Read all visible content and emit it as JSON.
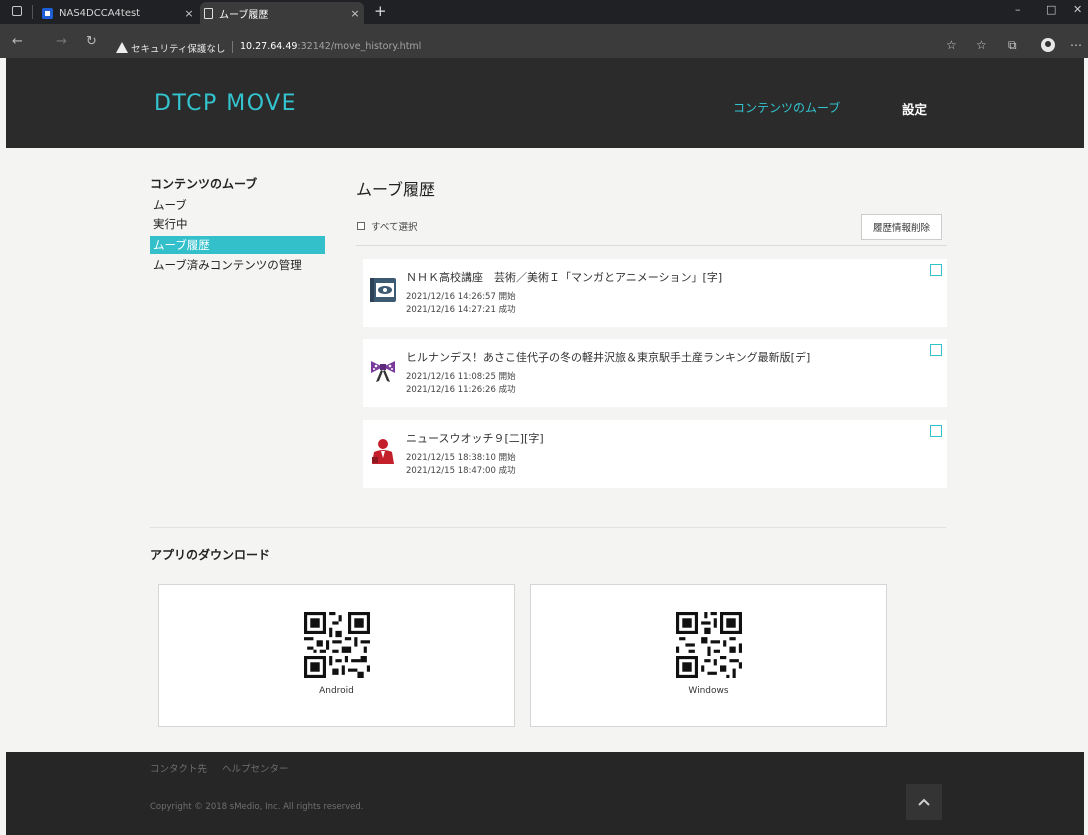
{
  "browser": {
    "tabs": [
      {
        "title": "NAS4DCCA4test",
        "close": "×"
      },
      {
        "title": "ムーブ履歴",
        "close": "×"
      }
    ],
    "new_tab": "+",
    "security_label": "セキュリティ保護なし",
    "url_host": "10.27.64.49",
    "url_path": ":32142/move_history.html"
  },
  "header": {
    "logo": "DTCP MOVE",
    "nav": [
      {
        "label": "コンテンツのムーブ"
      },
      {
        "label": "設定"
      }
    ]
  },
  "sidebar": {
    "heading": "コンテンツのムーブ",
    "items": [
      {
        "label": "ムーブ",
        "active": false
      },
      {
        "label": "実行中",
        "active": false
      },
      {
        "label": "ムーブ履歴",
        "active": true
      },
      {
        "label": "ムーブ済みコンテンツの管理",
        "active": false
      }
    ]
  },
  "main": {
    "title": "ムーブ履歴",
    "select_all_label": "すべて選択",
    "delete_button": "履歴情報削除",
    "history": [
      {
        "title": "ＮＨＫ高校講座　芸術／美術Ｉ「マンガとアニメーション」[字]",
        "start": "2021/12/16 14:26:57  開始",
        "end": "2021/12/16 14:27:21  成功",
        "icon": "book-eye-icon"
      },
      {
        "title": "ヒルナンデス！あさこ佳代子の冬の軽井沢旅＆東京駅手土産ランキング最新版[デ]",
        "start": "2021/12/16 11:08:25  開始",
        "end": "2021/12/16 11:26:26  成功",
        "icon": "ribbon-icon"
      },
      {
        "title": "ニュースウオッチ９[二][字]",
        "start": "2021/12/15 18:38:10  開始",
        "end": "2021/12/15 18:47:00  成功",
        "icon": "newscaster-icon"
      }
    ]
  },
  "downloads": {
    "title": "アプリのダウンロード",
    "items": [
      {
        "label": "Android"
      },
      {
        "label": "Windows"
      }
    ]
  },
  "footer": {
    "links": [
      {
        "label": "コンタクト先"
      },
      {
        "label": "ヘルプセンター"
      }
    ],
    "copyright": "Copyright © 2018 sMedio, Inc. All rights reserved."
  },
  "colors": {
    "accent": "#33c0cb",
    "header_bg": "#2b2b2b",
    "footer_bg": "#262626"
  }
}
